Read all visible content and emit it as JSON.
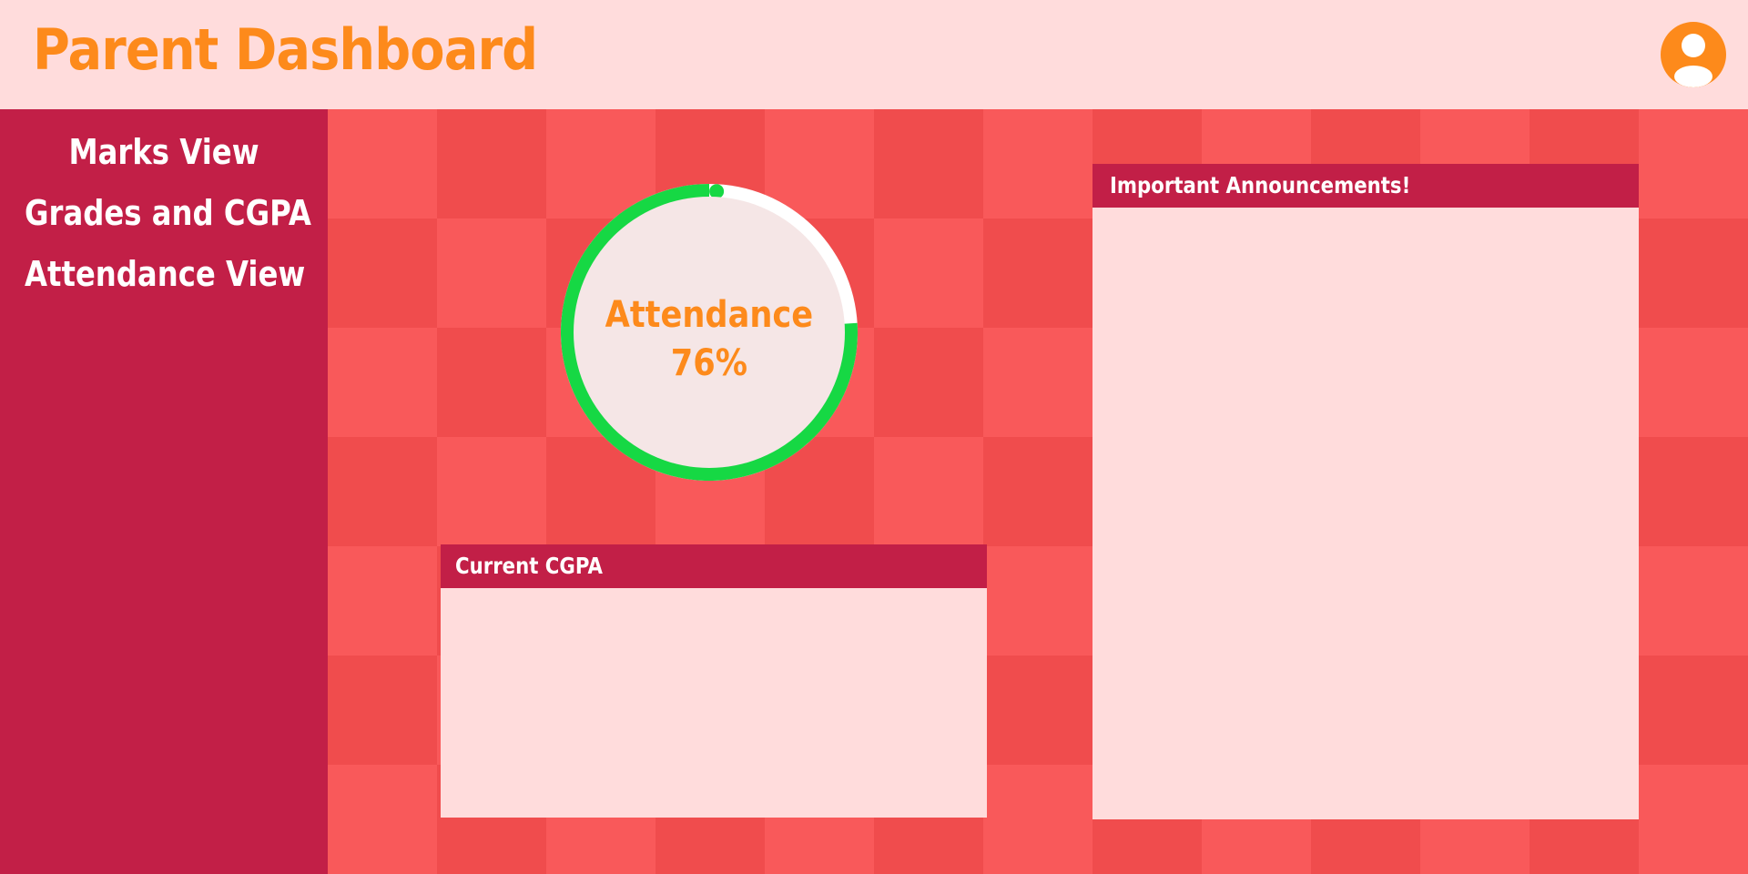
{
  "header": {
    "title": "Parent Dashboard",
    "profile_icon": "user-avatar-icon"
  },
  "sidebar": {
    "items": [
      {
        "label": "Marks View"
      },
      {
        "label": "Grades and CGPA"
      },
      {
        "label": "Attendance View"
      }
    ]
  },
  "attendance": {
    "label": "Attendance",
    "value_text": "76%",
    "percent": 76
  },
  "cgpa_panel": {
    "title": "Current CGPA"
  },
  "announcements_panel": {
    "title": "Important Announcements!"
  },
  "colors": {
    "brand_orange": "#fd8a1b",
    "sidebar": "#c21f47",
    "header_bg": "#ffdcdc",
    "tile_light": "#f9595a",
    "tile_dark": "#f04c4d",
    "progress_green": "#16d844",
    "track_white": "#ffffff",
    "gauge_inner": "#f5e6e6"
  }
}
